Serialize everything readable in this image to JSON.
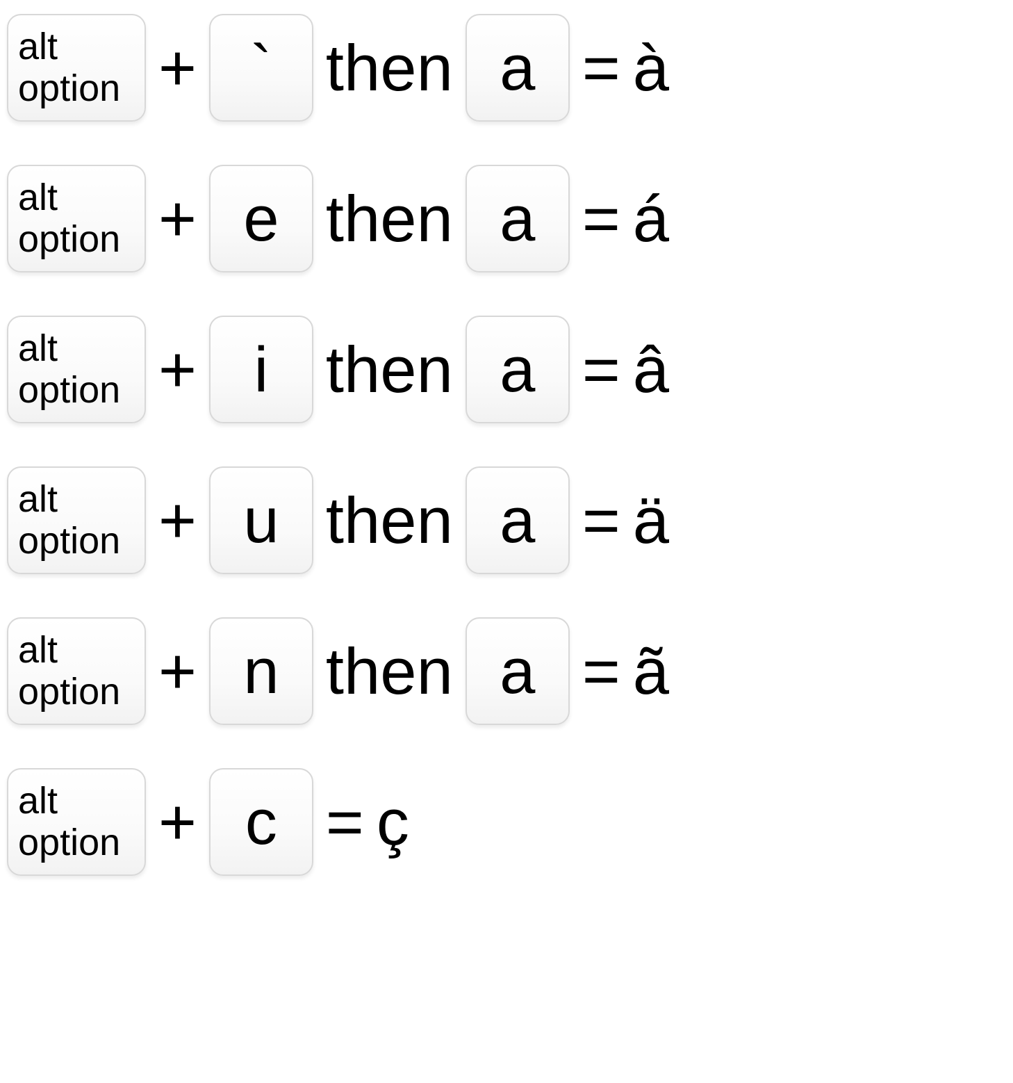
{
  "rows": [
    {
      "modifier_line1": "alt",
      "modifier_line2": "option",
      "operator1": "+",
      "key1": "`",
      "word": "then",
      "key2": "a",
      "operator2": "=",
      "result": "à",
      "has_second_key": true
    },
    {
      "modifier_line1": "alt",
      "modifier_line2": "option",
      "operator1": "+",
      "key1": "e",
      "word": "then",
      "key2": "a",
      "operator2": "=",
      "result": "á",
      "has_second_key": true
    },
    {
      "modifier_line1": "alt",
      "modifier_line2": "option",
      "operator1": "+",
      "key1": "i",
      "word": "then",
      "key2": "a",
      "operator2": "=",
      "result": "â",
      "has_second_key": true
    },
    {
      "modifier_line1": "alt",
      "modifier_line2": "option",
      "operator1": "+",
      "key1": "u",
      "word": "then",
      "key2": "a",
      "operator2": "=",
      "result": "ä",
      "has_second_key": true
    },
    {
      "modifier_line1": "alt",
      "modifier_line2": "option",
      "operator1": "+",
      "key1": "n",
      "word": "then",
      "key2": "a",
      "operator2": "=",
      "result": "ã",
      "has_second_key": true
    },
    {
      "modifier_line1": "alt",
      "modifier_line2": "option",
      "operator1": "+",
      "key1": "c",
      "word": "",
      "key2": "",
      "operator2": "=",
      "result": "ç",
      "has_second_key": false
    }
  ]
}
